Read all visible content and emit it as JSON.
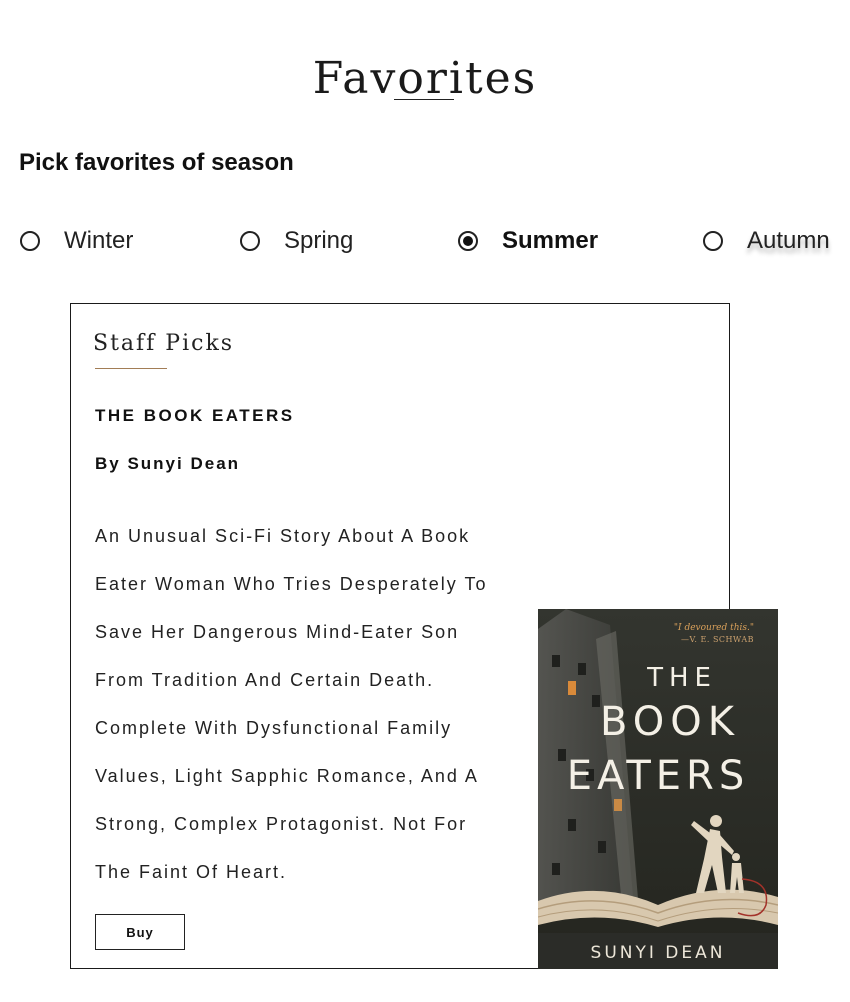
{
  "page": {
    "title": "Favorites"
  },
  "season_picker": {
    "question": "Pick favorites of season",
    "selected": "Summer",
    "options": [
      {
        "label": "Winter",
        "checked": false
      },
      {
        "label": "Spring",
        "checked": false
      },
      {
        "label": "Summer",
        "checked": true
      },
      {
        "label": "Autumn",
        "checked": false
      }
    ]
  },
  "card": {
    "heading": "Staff Picks",
    "book_title": "THE BOOK EATERS",
    "author_line": "By Sunyi Dean",
    "description_lines": [
      "An Unusual Sci-Fi Story About A Book",
      "Eater Woman Who Tries Desperately To",
      "Save Her Dangerous Mind-Eater Son",
      "From Tradition And Certain Death.",
      "Complete With Dysfunctional Family",
      "Values, Light Sapphic Romance, And A",
      "Strong, Complex Protagonist. Not For",
      "The Faint Of Heart."
    ],
    "buy_label": "Buy"
  },
  "cover": {
    "quote": "\"I devoured this.\"",
    "quote_attribution": "—V. E. SCHWAB",
    "title_line_1": "THE",
    "title_line_2": "BOOK",
    "title_line_3": "EATERS",
    "author": "SUNYI DEAN",
    "colors": {
      "background": "#2c2e2b",
      "title": "#f4f0e6",
      "quote": "#d9a05a",
      "paper": "#d8c8ae"
    }
  }
}
